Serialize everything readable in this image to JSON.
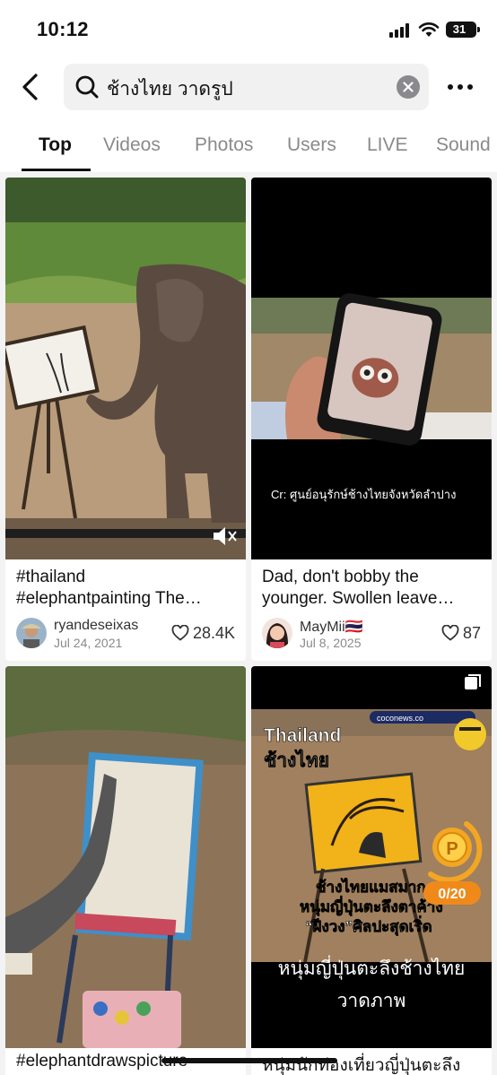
{
  "status": {
    "time": "10:12",
    "battery": "31"
  },
  "search": {
    "query": "ช้างไทย วาดรูป"
  },
  "tabs": [
    "Top",
    "Videos",
    "Photos",
    "Users",
    "LIVE",
    "Sound"
  ],
  "cards": [
    {
      "caption1": "#thailand",
      "caption2": "#elephantpainting The…",
      "user": "ryandeseixas",
      "date": "Jul 24, 2021",
      "likes": "28.4K"
    },
    {
      "overlay": "Cr: ศูนย์อนุรักษ์ช้างไทยจังหวัดลำปาง",
      "caption1": "Dad, don't bobby the",
      "caption2": "younger. Swollen leave…",
      "user": "MayMii🇹🇭",
      "date": "Jul 8, 2025",
      "likes": "87"
    },
    {
      "caption1": "#elephantdrawspicture"
    },
    {
      "brand": "coconews.co",
      "title1": "Thailand",
      "title2": "ช้างไทย",
      "headline1": "ช้างไทยแมสมาก",
      "headline2": "หนุ่มญี่ปุ่นตะลึงตาค้าง",
      "headline3": "“ฝีงวง”ศิลปะสุดเริ่ด",
      "subtitle1": "หนุ่มญี่ปุ่นตะลึงช้างไทย",
      "subtitle2": "วาดภาพ",
      "coin_progress": "0/20",
      "coin_letter": "P",
      "caption1": "หนุ่มนักท่องเที่ยวญี่ปุ่นตะลึง"
    }
  ],
  "colors": {
    "accent": "#111111",
    "inactive_tab": "#8a8a8e",
    "coin": "#f2a623"
  }
}
